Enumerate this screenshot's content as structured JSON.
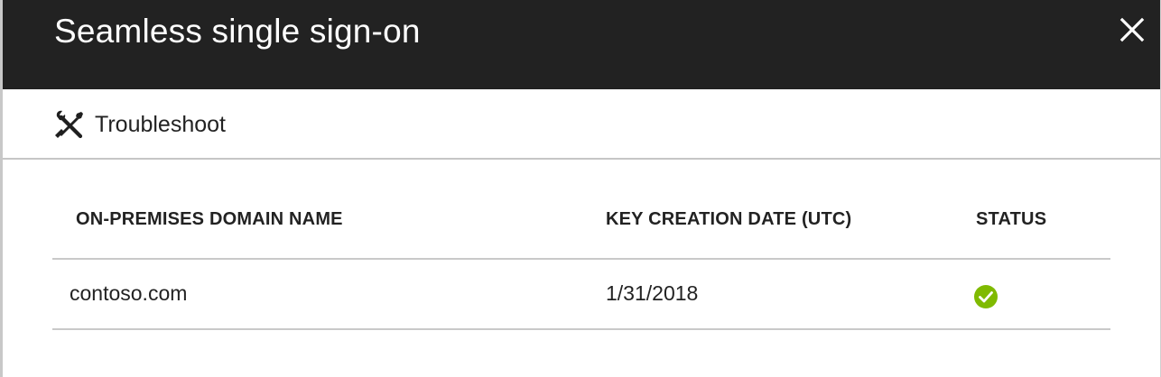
{
  "panel": {
    "title": "Seamless single sign-on",
    "close_icon": "close-icon"
  },
  "toolbar": {
    "troubleshoot_label": "Troubleshoot",
    "troubleshoot_icon": "wrench-screwdriver-icon"
  },
  "table": {
    "columns": [
      "ON-PREMISES DOMAIN NAME",
      "KEY CREATION DATE (UTC)",
      "STATUS"
    ],
    "rows": [
      {
        "domain": "contoso.com",
        "key_creation_date": "1/31/2018",
        "status_icon": "check-circle-icon",
        "status_color": "#7fba00"
      }
    ]
  },
  "colors": {
    "header_bg": "#222222",
    "success": "#7fba00"
  }
}
